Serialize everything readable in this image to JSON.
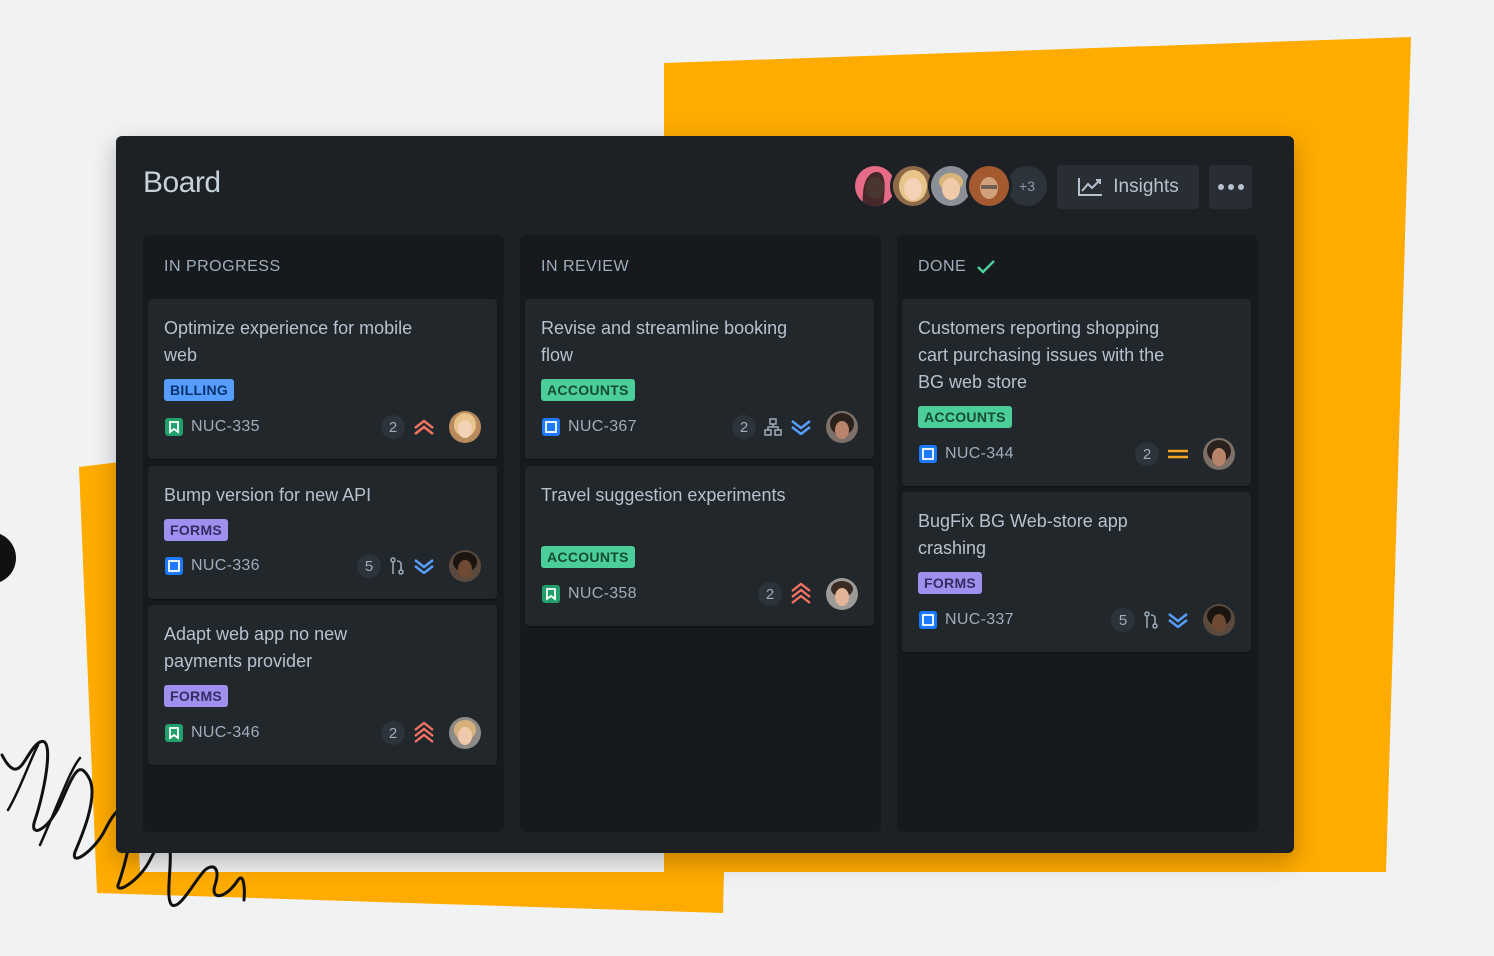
{
  "board": {
    "title": "Board",
    "more_avatars": "+3",
    "insights_label": "Insights",
    "more_icon": "more-horizontal-icon"
  },
  "colors": {
    "background": "#f1f2f4",
    "accent_shape": "#ffab00",
    "board_bg": "#1d2125",
    "column_bg": "#161a1d",
    "card_bg": "#22272b",
    "done_check": "#4bce97",
    "priority_high": "#f87462",
    "priority_low": "#579dff",
    "priority_medium": "#f5a623"
  },
  "columns": [
    {
      "title": "IN PROGRESS",
      "cards": [
        {
          "title": "Optimize experience for mobile web",
          "label": "BILLING",
          "key": "NUC-335",
          "type_icon": "story-icon",
          "count": "2",
          "priority_icon": "priority-high-icon"
        },
        {
          "title": "Bump version for new API",
          "label": "FORMS",
          "key": "NUC-336",
          "type_icon": "task-icon",
          "count": "5",
          "extra_icon": "pull-request-icon",
          "priority_icon": "priority-lowest-icon"
        },
        {
          "title": "Adapt web app no new payments provider",
          "label": "FORMS",
          "key": "NUC-346",
          "type_icon": "story-icon",
          "count": "2",
          "priority_icon": "priority-highest-icon"
        }
      ]
    },
    {
      "title": "IN REVIEW",
      "cards": [
        {
          "title": "Revise and streamline booking flow",
          "label": "ACCOUNTS",
          "key": "NUC-367",
          "type_icon": "task-icon",
          "count": "2",
          "extra_icon": "hierarchy-icon",
          "priority_icon": "priority-lowest-icon"
        },
        {
          "title": "Travel suggestion experiments",
          "label": "ACCOUNTS",
          "key": "NUC-358",
          "type_icon": "story-icon",
          "count": "2",
          "priority_icon": "priority-highest-icon"
        }
      ]
    },
    {
      "title": "DONE",
      "done_icon": "check-icon",
      "cards": [
        {
          "title": "Customers reporting shopping cart purchasing issues with the BG web store",
          "label": "ACCOUNTS",
          "key": "NUC-344",
          "type_icon": "task-icon",
          "count": "2",
          "priority_icon": "priority-medium-icon"
        },
        {
          "title": "BugFix BG Web-store app crashing",
          "label": "FORMS",
          "key": "NUC-337",
          "type_icon": "task-icon",
          "count": "5",
          "extra_icon": "pull-request-icon",
          "priority_icon": "priority-lowest-icon"
        }
      ]
    }
  ]
}
